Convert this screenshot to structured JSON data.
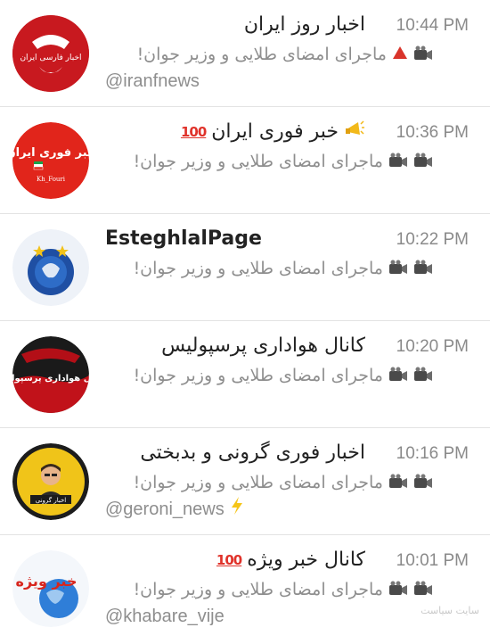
{
  "chats": [
    {
      "title": "اخبار روز ایران",
      "time": "10:44 PM",
      "preview": "ماجرای امضای طلایی و وزیر جوان!",
      "handle": "@iranfnews",
      "avatar_label": "اخبار فارسی ایران"
    },
    {
      "title": "خبر فوری ایران",
      "time": "10:36 PM",
      "preview": "ماجرای امضای طلایی و وزیر جوان!",
      "avatar_label": "خبر فوری ایران",
      "avatar_sub": "Kh_Fouri"
    },
    {
      "title": "EsteghlalPage",
      "time": "10:22 PM",
      "preview": "ماجرای امضای طلایی و وزیر جوان!"
    },
    {
      "title": "کانال هواداری پرسپولیس",
      "time": "10:20 PM",
      "preview": "ماجرای امضای طلایی و وزیر جوان!",
      "avatar_label": "کانال هواداری پرسپولیس"
    },
    {
      "title": "اخبار فوری گرونی و بدبختی",
      "time": "10:16 PM",
      "preview": "ماجرای امضای طلایی و وزیر جوان!",
      "handle": "@geroni_news",
      "avatar_label": "اخبار گرونی"
    },
    {
      "title": "کانال خبر ویژه",
      "time": "10:01 PM",
      "preview": "ماجرای امضای طلایی و وزیر جوان!",
      "handle": "@khabare_vije",
      "avatar_label": "خبر ویژه"
    }
  ],
  "watermark": "سایت سیاست",
  "icons": [
    "video-camera-icon",
    "red-triangle-icon",
    "megaphone-icon",
    "hundred-points-icon",
    "lightning-icon"
  ],
  "colors": {
    "time": "#8a8a8a",
    "preview": "#8e8e8e",
    "title": "#222222",
    "divider": "#e3e3e3"
  }
}
